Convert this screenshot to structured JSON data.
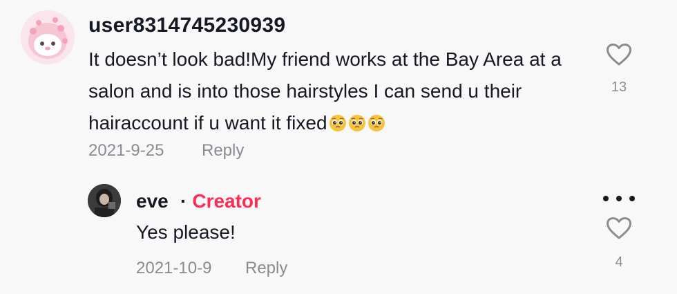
{
  "comments": {
    "main": {
      "username": "user8314745230939",
      "text": "It doesn’t look bad!My friend works at the Bay Area at a salon and is into those hairstyles I can send u their hairaccount if u want it fixed",
      "emojis": [
        "pleading-face",
        "pleading-face",
        "pleading-face"
      ],
      "date": "2021-9-25",
      "reply_label": "Reply",
      "like_count": "13"
    },
    "reply": {
      "username": "eve",
      "separator": "·",
      "badge": "Creator",
      "text": "Yes please!",
      "date": "2021-10-9",
      "reply_label": "Reply",
      "like_count": "4"
    }
  },
  "colors": {
    "background": "#f8f8f8",
    "text": "#161823",
    "muted": "#8a8b91",
    "creator_accent": "#fe2c55"
  },
  "icons": {
    "like": "heart-outline-icon",
    "more": "more-options-icon",
    "emoji": "pleading-face-emoji"
  }
}
